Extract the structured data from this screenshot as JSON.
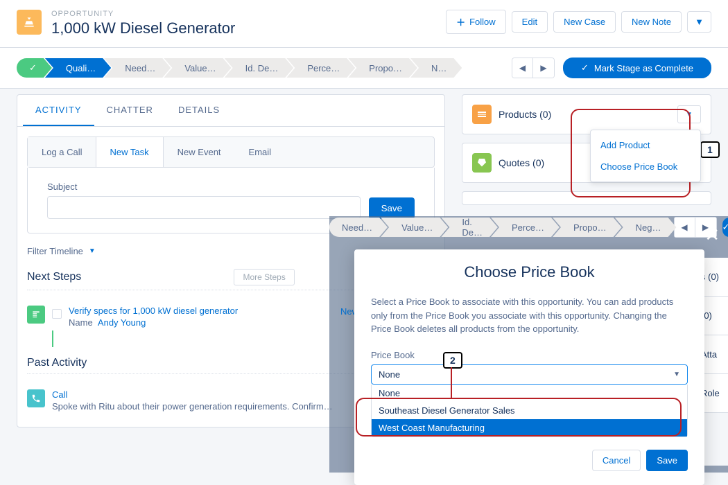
{
  "header": {
    "eyebrow": "OPPORTUNITY",
    "title": "1,000 kW Diesel Generator",
    "follow": "Follow",
    "edit": "Edit",
    "new_case": "New Case",
    "new_note": "New Note"
  },
  "path": {
    "stages": [
      "✓",
      "Quali…",
      "Need…",
      "Value…",
      "Id. De…",
      "Perce…",
      "Propo…",
      "N…"
    ],
    "mark_complete": "Mark Stage as Complete"
  },
  "main_tabs": [
    "ACTIVITY",
    "CHATTER",
    "DETAILS"
  ],
  "activity_tabs": [
    "Log a Call",
    "New Task",
    "New Event",
    "Email"
  ],
  "form": {
    "subject_label": "Subject",
    "save": "Save"
  },
  "timeline": {
    "filter": "Filter Timeline",
    "next_steps": "Next Steps",
    "more_steps": "More Steps",
    "task_link": "Verify specs for 1,000 kW diesel generator",
    "name_label": "Name",
    "name_value": "Andy Young",
    "past": "Past Activity",
    "call_title": "Call",
    "call_body": "Spoke with Ritu about their power generation requirements. Confirm…"
  },
  "cards": {
    "products": "Products (0)",
    "quotes": "Quotes (0)"
  },
  "dropdown": {
    "add_product": "Add Product",
    "choose_pb": "Choose Price Book"
  },
  "modal": {
    "bg_stages": [
      "Need…",
      "Value…",
      "Id. De…",
      "Perce…",
      "Propo…",
      "Neg…"
    ],
    "ghost_sidebar": [
      "s (0)",
      "(0)",
      "Atta",
      "Role"
    ],
    "ghost_new": "New",
    "title": "Choose Price Book",
    "desc": "Select a Price Book to associate with this opportunity. You can add products only from the Price Book you associate with this opportunity. Changing the Price Book deletes all products from the opportunity.",
    "field_label": "Price Book",
    "selected": "None",
    "options": [
      "None",
      "Southeast Diesel Generator Sales",
      "West Coast Manufacturing"
    ],
    "cancel": "Cancel",
    "save": "Save"
  },
  "callouts": {
    "one": "1",
    "two": "2"
  }
}
